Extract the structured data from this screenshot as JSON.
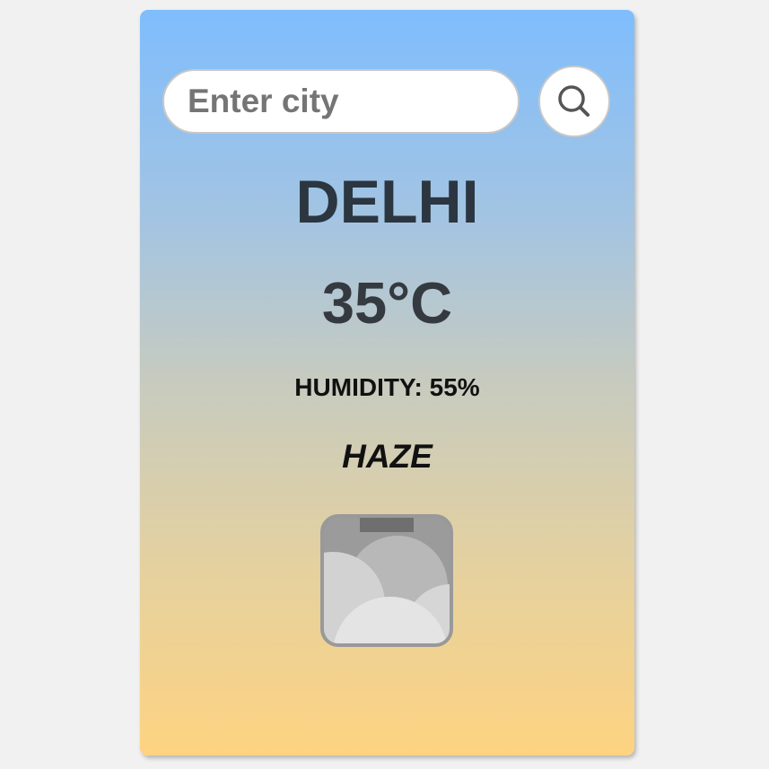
{
  "search": {
    "placeholder": "Enter city",
    "value": "",
    "button_icon": "search-icon"
  },
  "weather": {
    "city": "DELHI",
    "temperature": "35°C",
    "humidity": "HUMIDITY: 55%",
    "condition": "HAZE",
    "condition_icon": "haze-cloud-icon"
  },
  "colors": {
    "gradient_top": "#7fbdfd",
    "gradient_bottom": "#fed381",
    "city_text": "#2b3640",
    "page_background": "#f1f1f1"
  }
}
